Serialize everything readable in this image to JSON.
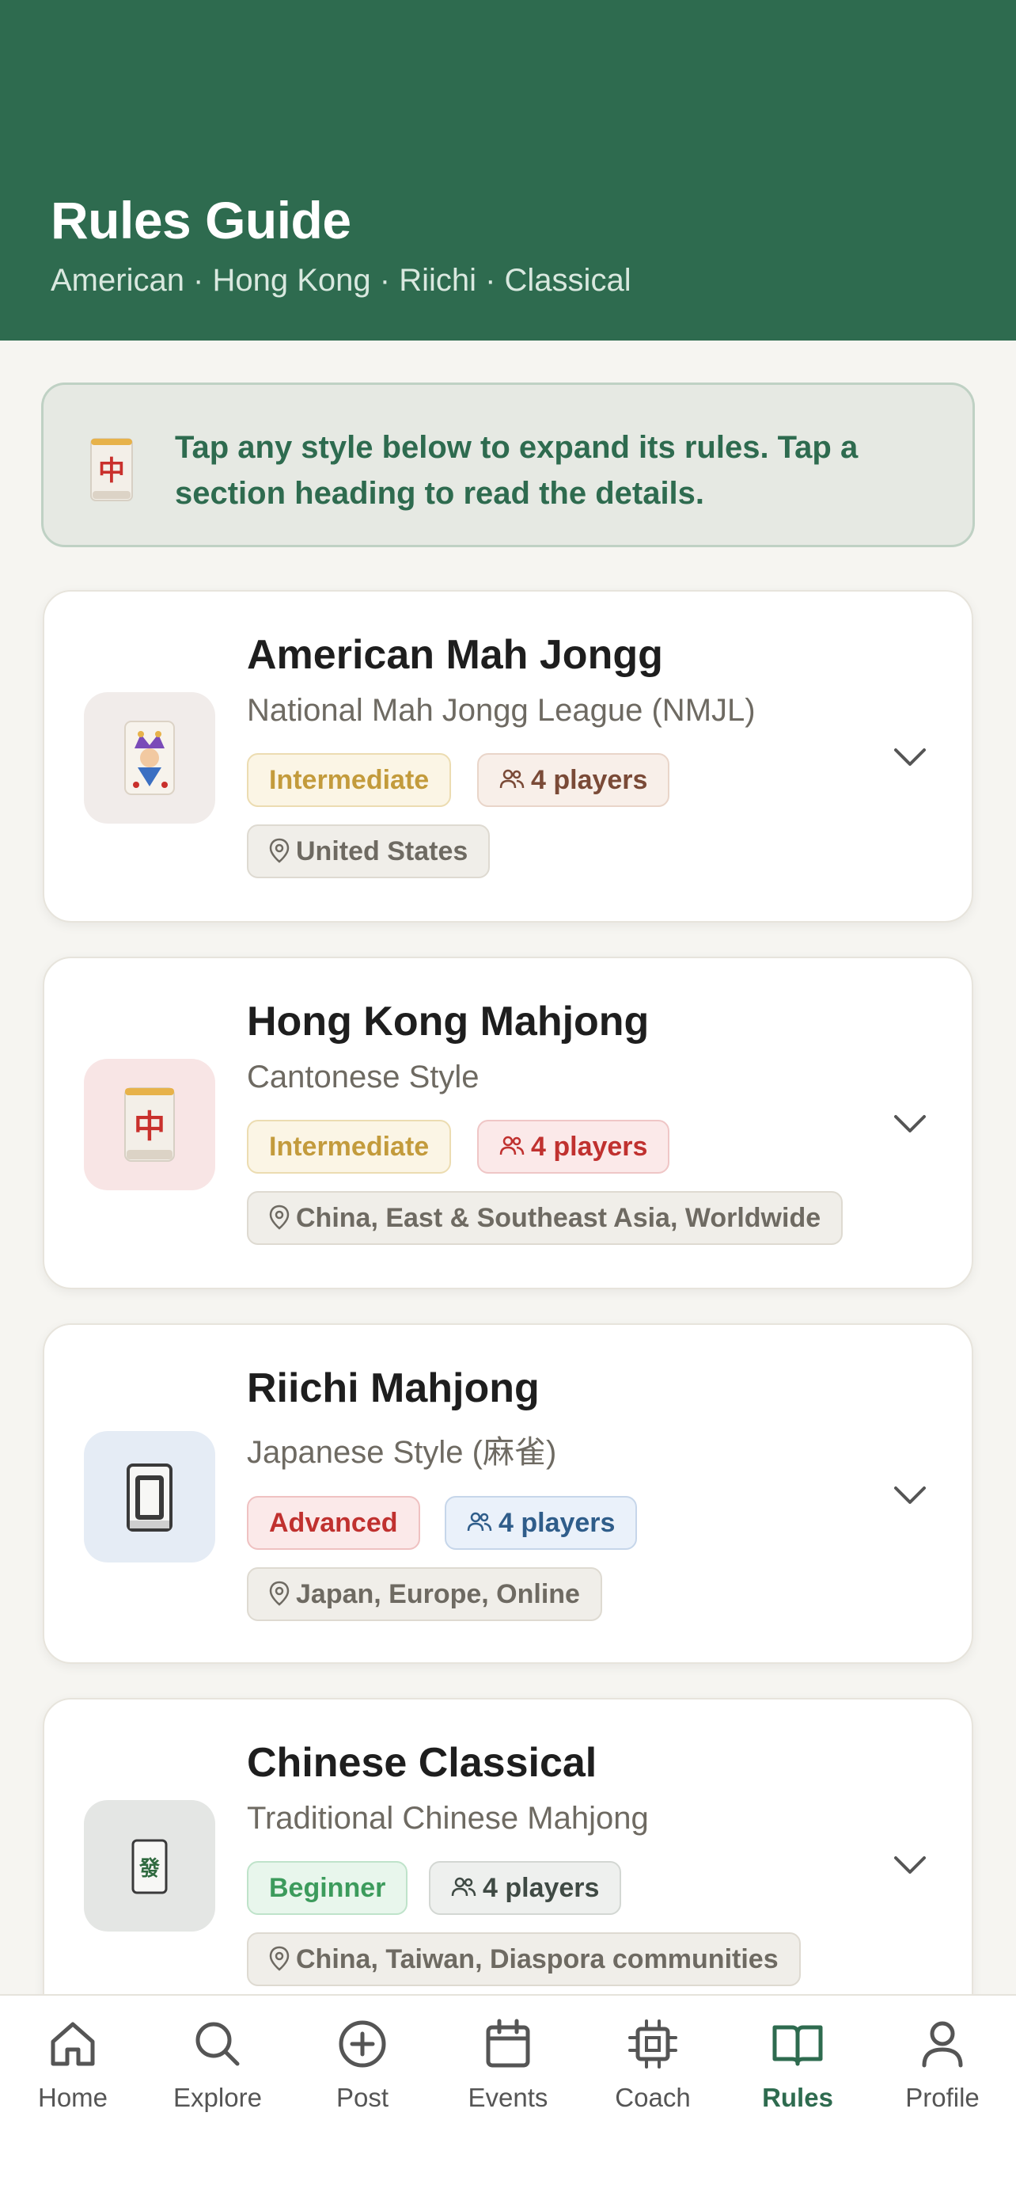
{
  "header": {
    "title": "Rules Guide",
    "subtitle": "American · Hong Kong · Riichi · Classical"
  },
  "tip": {
    "text": "Tap any style below to expand its rules. Tap a section heading to read the details.",
    "icon": "red-dragon-tile-icon"
  },
  "styles": [
    {
      "title": "American Mah Jongg",
      "subtitle": "National Mah Jongg League (NMJL)",
      "level": "Intermediate",
      "players": "4 players",
      "region": "United States",
      "icon": "joker-tile-icon",
      "icon_bg": "#f1ecea",
      "level_colors": {
        "bg": "#fbf5e5",
        "border": "#ecdcb1",
        "fg": "#c39b3c"
      },
      "players_colors": {
        "bg": "#f8efe9",
        "border": "#e9d5c9",
        "fg": "#7a4a37"
      }
    },
    {
      "title": "Hong Kong Mahjong",
      "subtitle": "Cantonese Style",
      "level": "Intermediate",
      "players": "4 players",
      "region": "China, East & Southeast Asia, Worldwide",
      "icon": "red-dragon-tile-icon",
      "icon_bg": "#f8e5e5",
      "level_colors": {
        "bg": "#fbf5e5",
        "border": "#ecdcb1",
        "fg": "#c39b3c"
      },
      "players_colors": {
        "bg": "#fbe9e9",
        "border": "#efc6c6",
        "fg": "#c0312f"
      }
    },
    {
      "title": "Riichi Mahjong",
      "subtitle": "Japanese Style (麻雀)",
      "level": "Advanced",
      "players": "4 players",
      "region": "Japan, Europe, Online",
      "icon": "white-dragon-tile-icon",
      "icon_bg": "#e5ecf5",
      "level_colors": {
        "bg": "#fbe9e9",
        "border": "#efc1c1",
        "fg": "#c0312f"
      },
      "players_colors": {
        "bg": "#eaf1fa",
        "border": "#c6d6ea",
        "fg": "#2f5d8a"
      }
    },
    {
      "title": "Chinese Classical",
      "subtitle": "Traditional Chinese Mahjong",
      "level": "Beginner",
      "players": "4 players",
      "region": "China, Taiwan, Diaspora communities",
      "icon": "green-dragon-tile-icon",
      "icon_bg": "#e4e6e4",
      "level_colors": {
        "bg": "#e8f6ec",
        "border": "#bfe3ca",
        "fg": "#3c9b5c"
      },
      "players_colors": {
        "bg": "#eef0ee",
        "border": "#d3d7d3",
        "fg": "#3f4a44"
      }
    }
  ],
  "nav": {
    "items": [
      {
        "label": "Home",
        "icon": "home-icon"
      },
      {
        "label": "Explore",
        "icon": "search-icon"
      },
      {
        "label": "Post",
        "icon": "plus-circle-icon"
      },
      {
        "label": "Events",
        "icon": "calendar-icon"
      },
      {
        "label": "Coach",
        "icon": "chip-icon"
      },
      {
        "label": "Rules",
        "icon": "book-icon",
        "active": true
      },
      {
        "label": "Profile",
        "icon": "user-icon"
      }
    ],
    "active_color": "#2e6b4f",
    "inactive_color": "#555555"
  },
  "colors": {
    "brand": "#2e6b4f",
    "background": "#f6f5f1"
  }
}
